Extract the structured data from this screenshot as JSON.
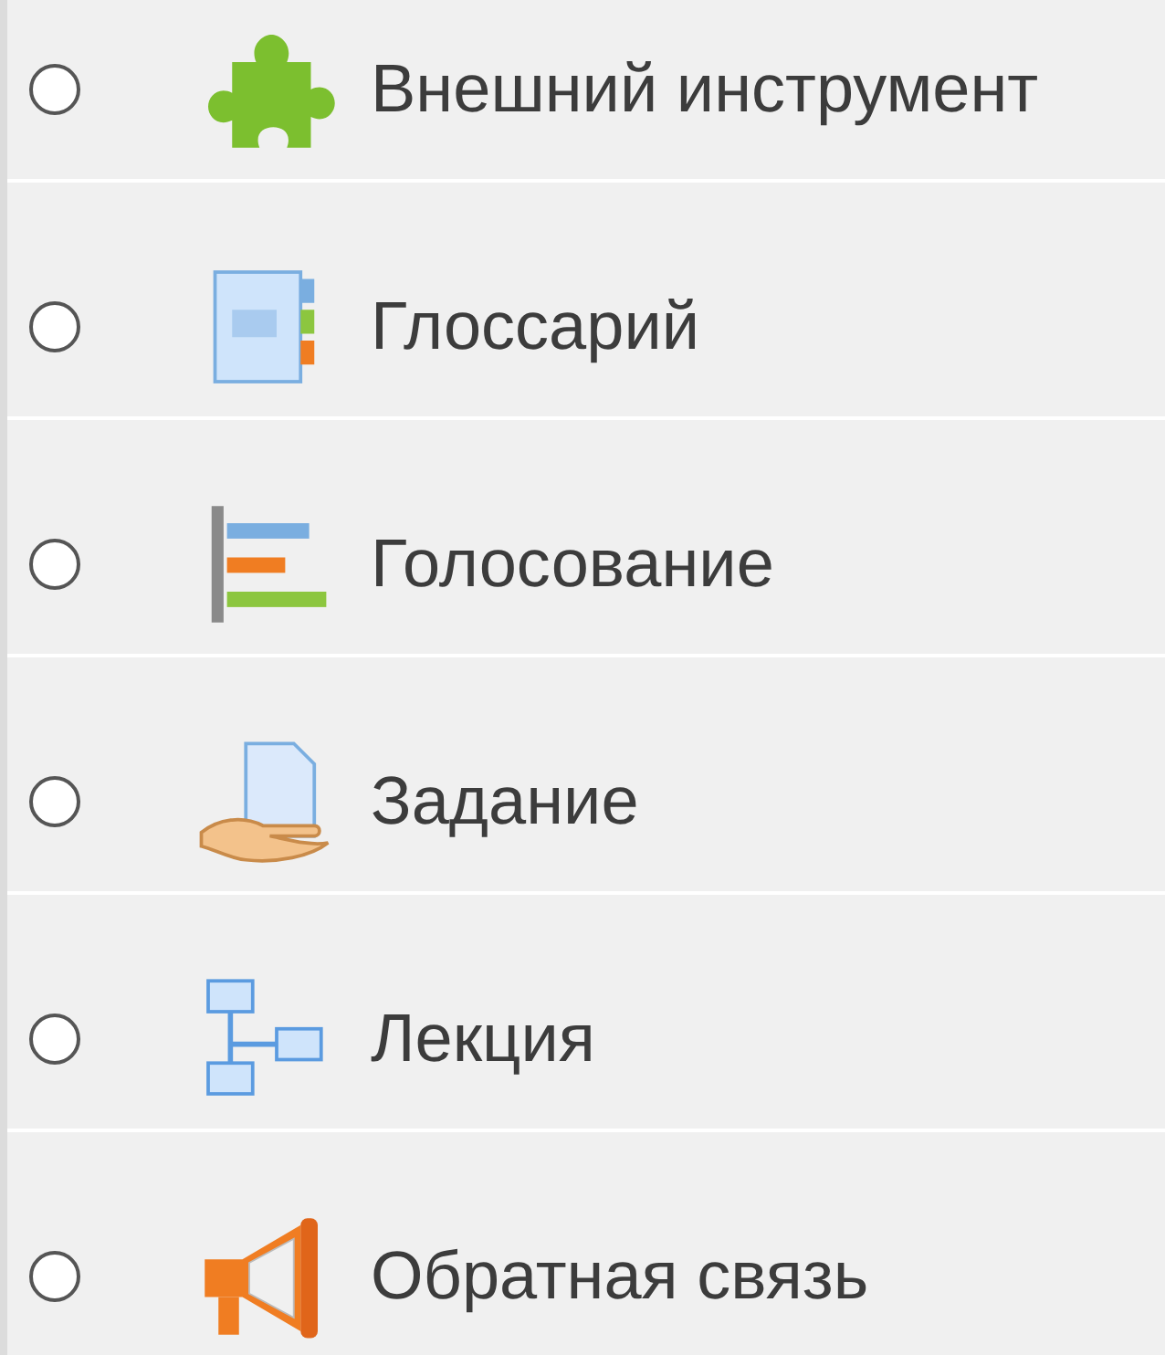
{
  "activities": [
    {
      "kind": "puzzle",
      "label": "Внешний инструмент",
      "selected": false
    },
    {
      "kind": "glossary",
      "label": "Глоссарий",
      "selected": false
    },
    {
      "kind": "bars",
      "label": "Голосование",
      "selected": false
    },
    {
      "kind": "assign",
      "label": "Задание",
      "selected": false
    },
    {
      "kind": "flow",
      "label": "Лекция",
      "selected": false
    },
    {
      "kind": "megaphone",
      "label": "Обратная связь",
      "selected": false
    }
  ]
}
